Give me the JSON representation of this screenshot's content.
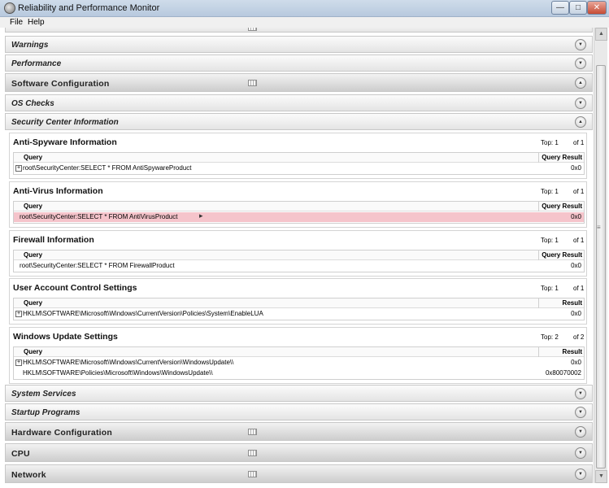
{
  "window": {
    "title": "Reliability and Performance Monitor",
    "controls": {
      "minimize": "—",
      "maximize": "□",
      "close": "✕"
    }
  },
  "menu": {
    "file": "File",
    "help": "Help"
  },
  "sections": {
    "warnings": "Warnings",
    "performance": "Performance",
    "software_configuration": "Software Configuration",
    "os_checks": "OS Checks",
    "security_center": "Security Center Information",
    "system_services": "System Services",
    "startup_programs": "Startup Programs",
    "hardware_configuration": "Hardware Configuration",
    "cpu": "CPU",
    "network": "Network"
  },
  "glyphs": {
    "expand": "▼",
    "collapse": "▲",
    "plus": "+",
    "pointer": "▸",
    "scroll_up": "▲",
    "scroll_down": "▼",
    "grip": "≡"
  },
  "icons": [
    "app-icon",
    "table-icon",
    "expand-icon",
    "collapse-icon",
    "plus-icon"
  ],
  "panels": {
    "antispyware": {
      "title": "Anti-Spyware Information",
      "top": "Top: 1",
      "of": "of 1",
      "col_query": "Query",
      "col_result": "Query Result",
      "rows": [
        {
          "query": "root\\SecurityCenter:SELECT * FROM AntiSpywareProduct",
          "result": "0x0"
        }
      ]
    },
    "antivirus": {
      "title": "Anti-Virus Information",
      "top": "Top: 1",
      "of": "of 1",
      "col_query": "Query",
      "col_result": "Query Result",
      "rows": [
        {
          "query": "root\\SecurityCenter:SELECT * FROM AntiVirusProduct",
          "result": "0x0"
        }
      ]
    },
    "firewall": {
      "title": "Firewall Information",
      "top": "Top: 1",
      "of": "of 1",
      "col_query": "Query",
      "col_result": "Query Result",
      "rows": [
        {
          "query": "root\\SecurityCenter:SELECT * FROM FirewallProduct",
          "result": "0x0"
        }
      ]
    },
    "uac": {
      "title": "User Account Control Settings",
      "top": "Top: 1",
      "of": "of 1",
      "col_query": "Query",
      "col_result": "Result",
      "rows": [
        {
          "query": "HKLM\\SOFTWARE\\Microsoft\\Windows\\CurrentVersion\\Policies\\System\\EnableLUA",
          "result": "0x0"
        }
      ]
    },
    "windows_update": {
      "title": "Windows Update Settings",
      "top": "Top: 2",
      "of": "of 2",
      "col_query": "Query",
      "col_result": "Result",
      "rows": [
        {
          "query": "HKLM\\SOFTWARE\\Microsoft\\Windows\\CurrentVersion\\WindowsUpdate\\\\",
          "result": "0x0"
        },
        {
          "query": "HKLM\\SOFTWARE\\Policies\\Microsoft\\Windows\\WindowsUpdate\\\\",
          "result": "0x80070002"
        }
      ]
    }
  },
  "colors": {
    "highlight_row": "#f5c4cb",
    "title_bar": "#c3d3e6",
    "close_button": "#c64b34"
  }
}
